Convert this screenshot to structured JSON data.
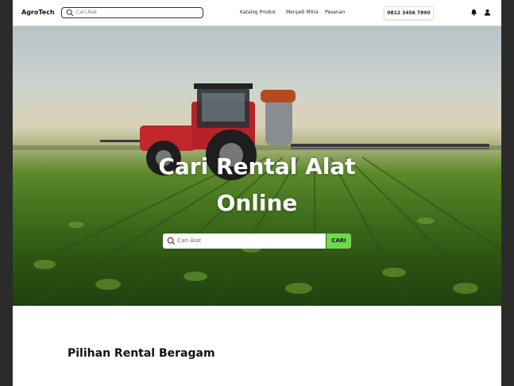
{
  "header": {
    "logo": "AgroTech",
    "search_placeholder": "Cari Alat",
    "nav": [
      "Katalog Produk",
      "Menjadi Mitra",
      "Pesanan"
    ],
    "phone": "0812 3456 7890",
    "icons": [
      "search-icon",
      "bell-icon",
      "user-icon"
    ]
  },
  "hero": {
    "title_line1": "Cari Rental Alat",
    "title_line2": "Online",
    "search_placeholder": "Cari Alat",
    "search_button": "CARI",
    "accent": "#6ed94a"
  },
  "section": {
    "title": "Pilihan Rental Beragam"
  }
}
